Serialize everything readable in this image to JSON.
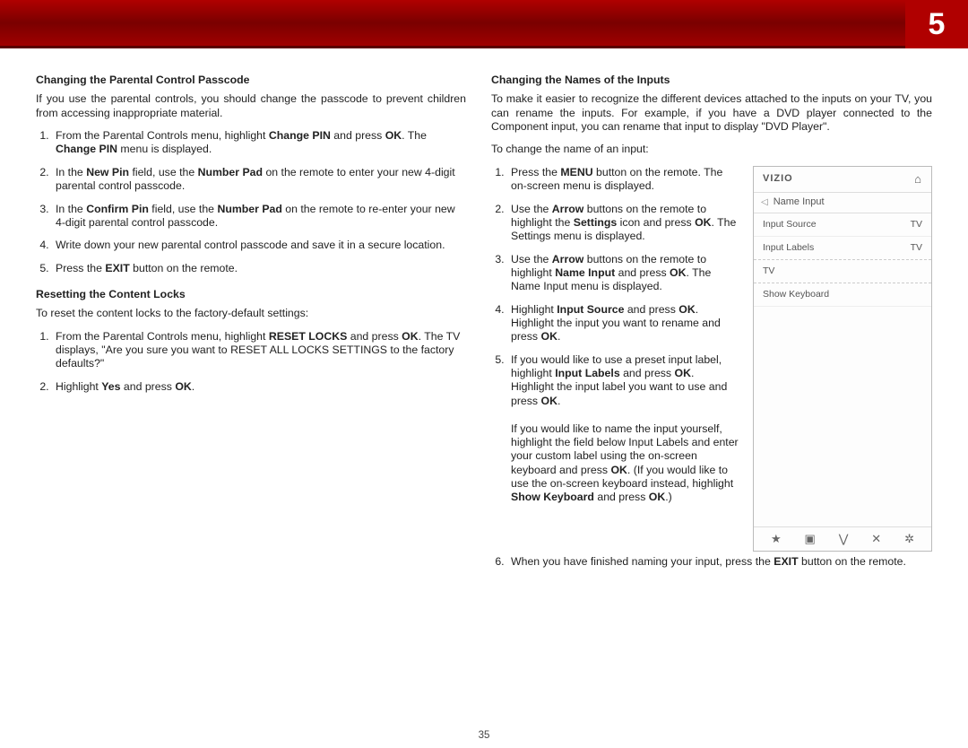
{
  "chapter_number": "5",
  "page_number": "35",
  "left": {
    "sec1_title": "Changing the Parental Control Passcode",
    "sec1_intro": "If you use the parental controls, you should change the passcode to prevent children from accessing inappropriate material.",
    "sec1_s1a": "From the Parental Controls menu, highlight ",
    "sec1_s1b": "Change PIN",
    "sec1_s1c": " and press ",
    "sec1_s1d": "OK",
    "sec1_s1e": ". The ",
    "sec1_s1f": "Change PIN",
    "sec1_s1g": " menu is displayed.",
    "sec1_s2a": "In the ",
    "sec1_s2b": "New Pin",
    "sec1_s2c": " field, use the ",
    "sec1_s2d": "Number Pad",
    "sec1_s2e": " on the remote to enter your new 4-digit parental control passcode.",
    "sec1_s3a": "In the ",
    "sec1_s3b": "Confirm Pin",
    "sec1_s3c": " field, use the ",
    "sec1_s3d": "Number Pad",
    "sec1_s3e": " on the remote to re-enter your new 4-digit parental control passcode.",
    "sec1_s4": "Write down your new parental control passcode and save it in a secure location.",
    "sec1_s5a": "Press the ",
    "sec1_s5b": "EXIT",
    "sec1_s5c": " button on the remote.",
    "sec2_title": "Resetting the Content Locks",
    "sec2_intro": "To reset the content locks to the factory-default settings:",
    "sec2_s1a": "From the Parental Controls menu, highlight ",
    "sec2_s1b": "RESET LOCKS",
    "sec2_s1c": " and press ",
    "sec2_s1d": "OK",
    "sec2_s1e": ". The TV displays, \"Are you sure you want to RESET ALL LOCKS SETTINGS to the factory defaults?\"",
    "sec2_s2a": "Highlight ",
    "sec2_s2b": "Yes",
    "sec2_s2c": " and press ",
    "sec2_s2d": "OK",
    "sec2_s2e": "."
  },
  "right": {
    "sec1_title": "Changing the Names of the Inputs",
    "sec1_intro": "To make it easier to recognize the different devices attached to the inputs on your TV, you can rename the inputs. For example, if you have a DVD player connected to the Component input, you can rename that input to display \"DVD Player\".",
    "sec1_lead": "To change the name of an input:",
    "s1a": "Press the ",
    "s1b": "MENU",
    "s1c": " button on the remote. The on-screen menu is displayed.",
    "s2a": "Use the ",
    "s2b": "Arrow",
    "s2c": " buttons on the remote to highlight the ",
    "s2d": "Settings",
    "s2e": " icon and press ",
    "s2f": "OK",
    "s2g": ". The Settings menu is displayed.",
    "s3a": "Use the ",
    "s3b": "Arrow",
    "s3c": " buttons on the remote to highlight ",
    "s3d": "Name Input",
    "s3e": " and press ",
    "s3f": "OK",
    "s3g": ". The Name Input menu is displayed.",
    "s4a": "Highlight ",
    "s4b": "Input Source",
    "s4c": " and press ",
    "s4d": "OK",
    "s4e": ". Highlight the input you want to rename and press ",
    "s4f": "OK",
    "s4g": ".",
    "s5a": "If you would like to use a preset input label, highlight ",
    "s5b": "Input Labels",
    "s5c": " and press ",
    "s5d": "OK",
    "s5e": ". Highlight the input label you want to use and press ",
    "s5f": "OK",
    "s5g": ".",
    "s5h": "If you would like to name the input yourself, highlight the field below Input Labels and enter your custom label using the on-screen keyboard and press ",
    "s5i": "OK",
    "s5j": ". (If you would like to use the on-screen keyboard instead, highlight ",
    "s5k": "Show Keyboard",
    "s5l": " and press ",
    "s5m": "OK",
    "s5n": ".)",
    "s6a": "When you have finished naming your input, press the ",
    "s6b": "EXIT",
    "s6c": " button on the remote."
  },
  "panel": {
    "brand": "VIZIO",
    "title": "Name Input",
    "row1_label": "Input Source",
    "row1_val": "TV",
    "row2_label": "Input Labels",
    "row2_val": "TV",
    "row3_label": "TV",
    "row4_label": "Show Keyboard",
    "foot_star": "★",
    "foot_pip": "▣",
    "foot_v": "⋁",
    "foot_x": "✕",
    "foot_gear": "✲"
  }
}
